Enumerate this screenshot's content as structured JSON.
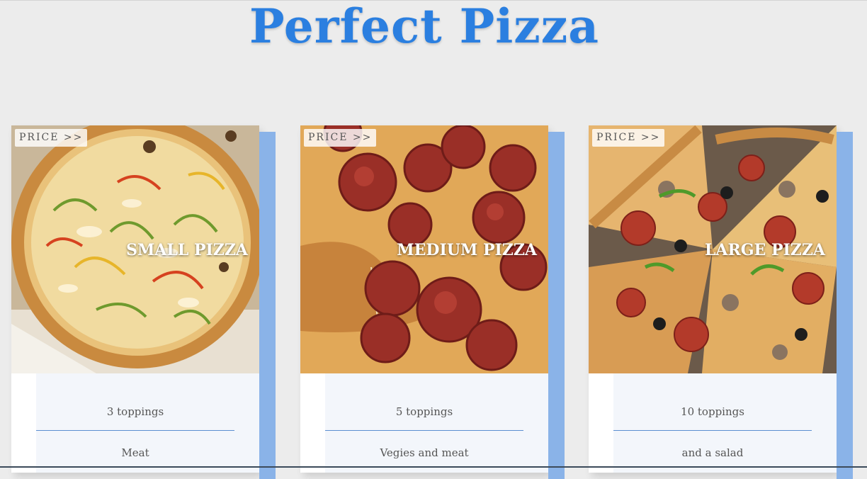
{
  "page": {
    "title": "Perfect Pizza",
    "title_color": "#2b7fe0",
    "accent_color": "#8ab3e8"
  },
  "cards": [
    {
      "price_label": "PRICE >>",
      "name": "SMALL PIZZA",
      "toppings": "3 toppings",
      "extra": "Meat",
      "image": "veggie-pizza-photo"
    },
    {
      "price_label": "PRICE >>",
      "name": "MEDIUM PIZZA",
      "toppings": "5 toppings",
      "extra": "Vegies and meat",
      "image": "pepperoni-pizza-photo"
    },
    {
      "price_label": "PRICE >>",
      "name": "LARGE PIZZA",
      "toppings": "10 toppings",
      "extra": "and a salad",
      "image": "supreme-pizza-photo"
    }
  ]
}
